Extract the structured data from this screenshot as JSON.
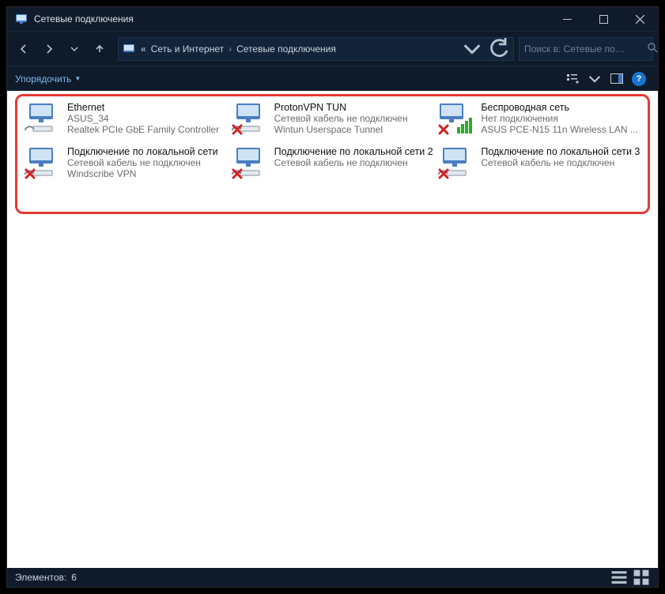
{
  "title": "Сетевые подключения",
  "breadcrumb": {
    "prefix": "«",
    "seg1": "Сеть и Интернет",
    "seg2": "Сетевые подключения"
  },
  "search": {
    "placeholder": "Поиск в: Сетевые по…"
  },
  "toolbar": {
    "organize": "Упорядочить"
  },
  "statusbar": {
    "label": "Элементов:",
    "count": "6"
  },
  "connections": [
    {
      "name": "Ethernet",
      "status": "ASUS_34",
      "desc": "Realtek PCIe GbE Family Controller",
      "error": false,
      "kind": "ethernet"
    },
    {
      "name": "ProtonVPN TUN",
      "status": "Сетевой кабель не подключен",
      "desc": "Wintun Userspace Tunnel",
      "error": true,
      "kind": "ethernet"
    },
    {
      "name": "Беспроводная сеть",
      "status": "Нет подключения",
      "desc": "ASUS PCE-N15 11n Wireless LAN ...",
      "error": true,
      "kind": "wifi"
    },
    {
      "name": "Подключение по локальной сети",
      "status": "Сетевой кабель не подключен",
      "desc": "Windscribe VPN",
      "error": true,
      "kind": "ethernet"
    },
    {
      "name": "Подключение по локальной сети 2",
      "status": "Сетевой кабель не подключен",
      "desc": "",
      "error": true,
      "kind": "ethernet"
    },
    {
      "name": "Подключение по локальной сети 3",
      "status": "Сетевой кабель не подключен",
      "desc": "",
      "error": true,
      "kind": "ethernet"
    }
  ]
}
